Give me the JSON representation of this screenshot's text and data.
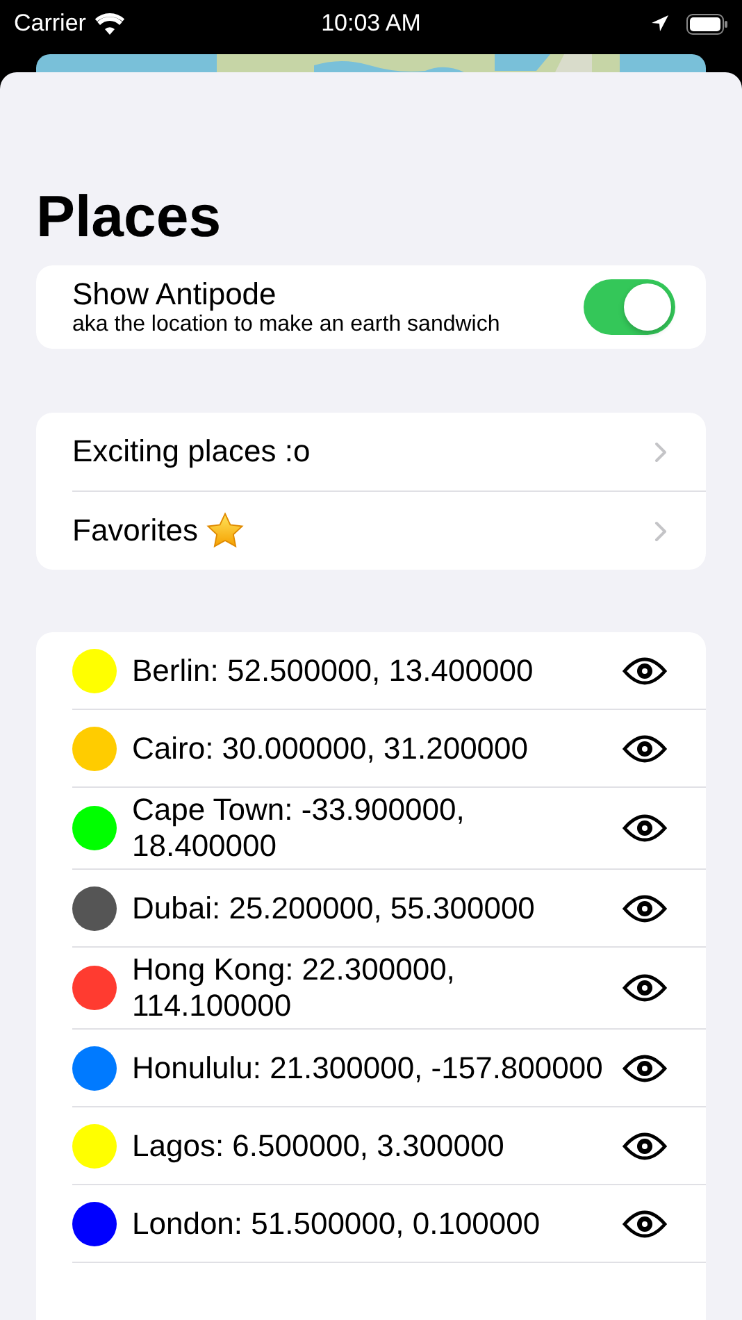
{
  "status_bar": {
    "carrier": "Carrier",
    "time": "10:03 AM"
  },
  "title": "Places",
  "antipode": {
    "label": "Show Antipode",
    "subtitle": "aka the location to make an earth sandwich",
    "on": true
  },
  "links": [
    {
      "label": "Exciting places :o",
      "kind": "plain"
    },
    {
      "label": "Favorites",
      "kind": "starred"
    }
  ],
  "places": [
    {
      "text": "Berlin: 52.500000, 13.400000",
      "color": "#ffff00"
    },
    {
      "text": "Cairo: 30.000000, 31.200000",
      "color": "#ffcc00"
    },
    {
      "text": "Cape Town: -33.900000, 18.400000",
      "color": "#00ff00"
    },
    {
      "text": "Dubai: 25.200000, 55.300000",
      "color": "#555555"
    },
    {
      "text": "Hong Kong: 22.300000, 114.100000",
      "color": "#ff3b30"
    },
    {
      "text": "Honululu: 21.300000, -157.800000",
      "color": "#007aff"
    },
    {
      "text": "Lagos: 6.500000, 3.300000",
      "color": "#ffff00"
    },
    {
      "text": "London: 51.500000, 0.100000",
      "color": "#0000ff"
    }
  ]
}
